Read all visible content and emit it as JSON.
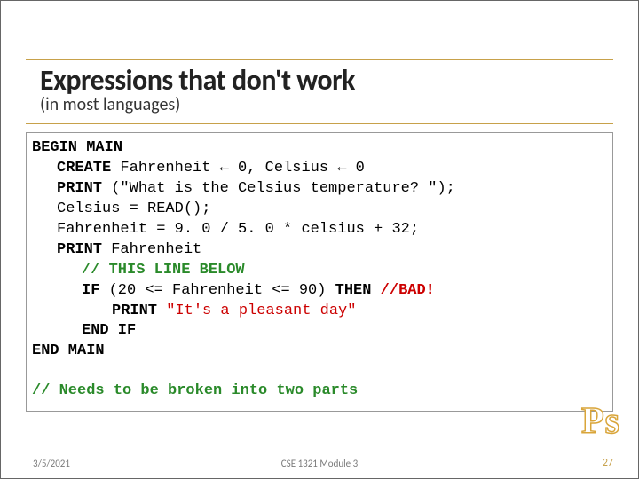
{
  "header": {
    "title": "Expressions that don't work",
    "subtitle": "(in most languages)"
  },
  "code": {
    "l1_kw": "BEGIN MAIN",
    "l2a": "CREATE",
    "l2b": " Fahrenheit ← 0, Celsius ← 0",
    "l3a": "PRINT",
    "l3b": " (\"What is the Celsius temperature? \");",
    "l4": "Celsius = READ();",
    "l5": "Fahrenheit = 9. 0 / 5. 0 * celsius + 32;",
    "l6a": "PRINT",
    "l6b": " Fahrenheit",
    "l7": "// THIS LINE BELOW",
    "l8a": "IF",
    "l8b": " (20 <= Fahrenheit <= 90) ",
    "l8c": "THEN",
    "l8d": " //BAD!",
    "l9a": "PRINT",
    "l9b": " \"It's a pleasant day\"",
    "l10": "END IF",
    "l11": "END MAIN",
    "note": "// Needs to be broken into two parts"
  },
  "badge": "Ps",
  "footer": {
    "date": "3/5/2021",
    "center": "CSE 1321 Module 3",
    "page": "27"
  }
}
